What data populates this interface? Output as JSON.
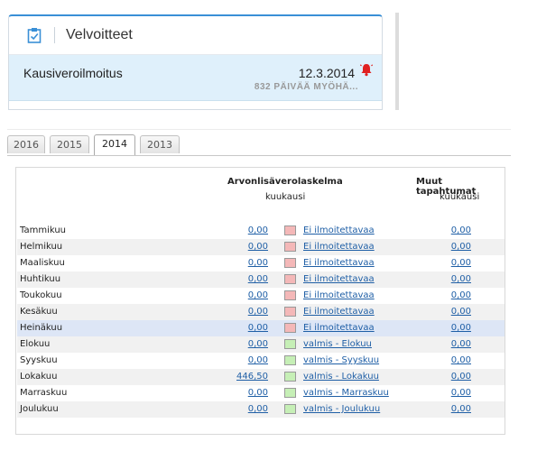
{
  "card": {
    "title": "Velvoitteet",
    "item_name": "Kausiveroilmoitus",
    "item_date": "12.3.2014",
    "item_overdue": "832 PÄIVÄÄ MYÖHÄ...",
    "accent": "#3a8fd6",
    "row_bg": "#dff0fb",
    "bell_color": "#e02020"
  },
  "tabs": [
    {
      "label": "2016",
      "active": false
    },
    {
      "label": "2015",
      "active": false
    },
    {
      "label": "2014",
      "active": true
    },
    {
      "label": "2013",
      "active": false
    }
  ],
  "table": {
    "col1_title": "Arvonlisäverolaskelma",
    "col1_sub": "kuukausi",
    "col2_title": "Muut tapahtumat",
    "col2_sub": "kuukausi",
    "swatch_colors": {
      "pink": "#f4b8b8",
      "green": "#c6efb6"
    },
    "rows": [
      {
        "month": "Tammikuu",
        "value": "0,00",
        "status": "Ei ilmoitettavaa",
        "swatch": "pink",
        "other": "0,00"
      },
      {
        "month": "Helmikuu",
        "value": "0,00",
        "status": "Ei ilmoitettavaa",
        "swatch": "pink",
        "other": "0,00"
      },
      {
        "month": "Maaliskuu",
        "value": "0,00",
        "status": "Ei ilmoitettavaa",
        "swatch": "pink",
        "other": "0,00"
      },
      {
        "month": "Huhtikuu",
        "value": "0,00",
        "status": "Ei ilmoitettavaa",
        "swatch": "pink",
        "other": "0,00"
      },
      {
        "month": "Toukokuu",
        "value": "0,00",
        "status": "Ei ilmoitettavaa",
        "swatch": "pink",
        "other": "0,00"
      },
      {
        "month": "Kesäkuu",
        "value": "0,00",
        "status": "Ei ilmoitettavaa",
        "swatch": "pink",
        "other": "0,00"
      },
      {
        "month": "Heinäkuu",
        "value": "0,00",
        "status": "Ei ilmoitettavaa",
        "swatch": "pink",
        "other": "0,00",
        "highlight": true
      },
      {
        "month": "Elokuu",
        "value": "0,00",
        "status": "valmis - Elokuu",
        "swatch": "green",
        "other": "0,00"
      },
      {
        "month": "Syyskuu",
        "value": "0,00",
        "status": "valmis - Syyskuu",
        "swatch": "green",
        "other": "0,00"
      },
      {
        "month": "Lokakuu",
        "value": "446,50",
        "status": "valmis - Lokakuu",
        "swatch": "green",
        "other": "0,00"
      },
      {
        "month": "Marraskuu",
        "value": "0,00",
        "status": "valmis - Marraskuu",
        "swatch": "green",
        "other": "0,00"
      },
      {
        "month": "Joulukuu",
        "value": "0,00",
        "status": "valmis - Joulukuu",
        "swatch": "green",
        "other": "0,00"
      }
    ]
  }
}
